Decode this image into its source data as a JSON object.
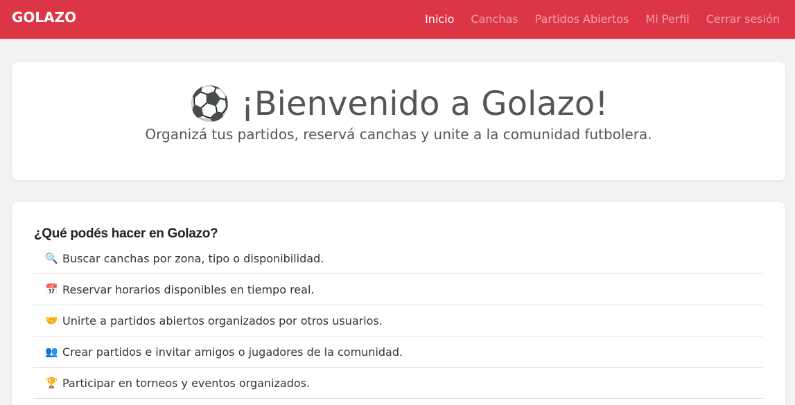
{
  "navbar": {
    "brand": "GOLAZO",
    "links": [
      "Inicio",
      "Canchas",
      "Partidos Abiertos",
      "Mi Perfil",
      "Cerrar sesión"
    ],
    "active": "Inicio",
    "color": "#dc3545"
  },
  "hero": {
    "icon": "⚽",
    "title": "¡Bienvenido a Golazo!",
    "subtitle": "Organizá tus partidos, reservá canchas y unite a la comunidad futbolera."
  },
  "features": {
    "title": "¿Qué podés hacer en Golazo?",
    "items": [
      {
        "icon": "🔍",
        "text": "Buscar canchas por zona, tipo o disponibilidad."
      },
      {
        "icon": "📅",
        "text": "Reservar horarios disponibles en tiempo real."
      },
      {
        "icon": "🤝",
        "text": "Unirte a partidos abiertos organizados por otros usuarios."
      },
      {
        "icon": "👥",
        "text": "Crear partidos e invitar amigos o jugadores de la comunidad."
      },
      {
        "icon": "🏆",
        "text": "Participar en torneos y eventos organizados."
      }
    ]
  }
}
